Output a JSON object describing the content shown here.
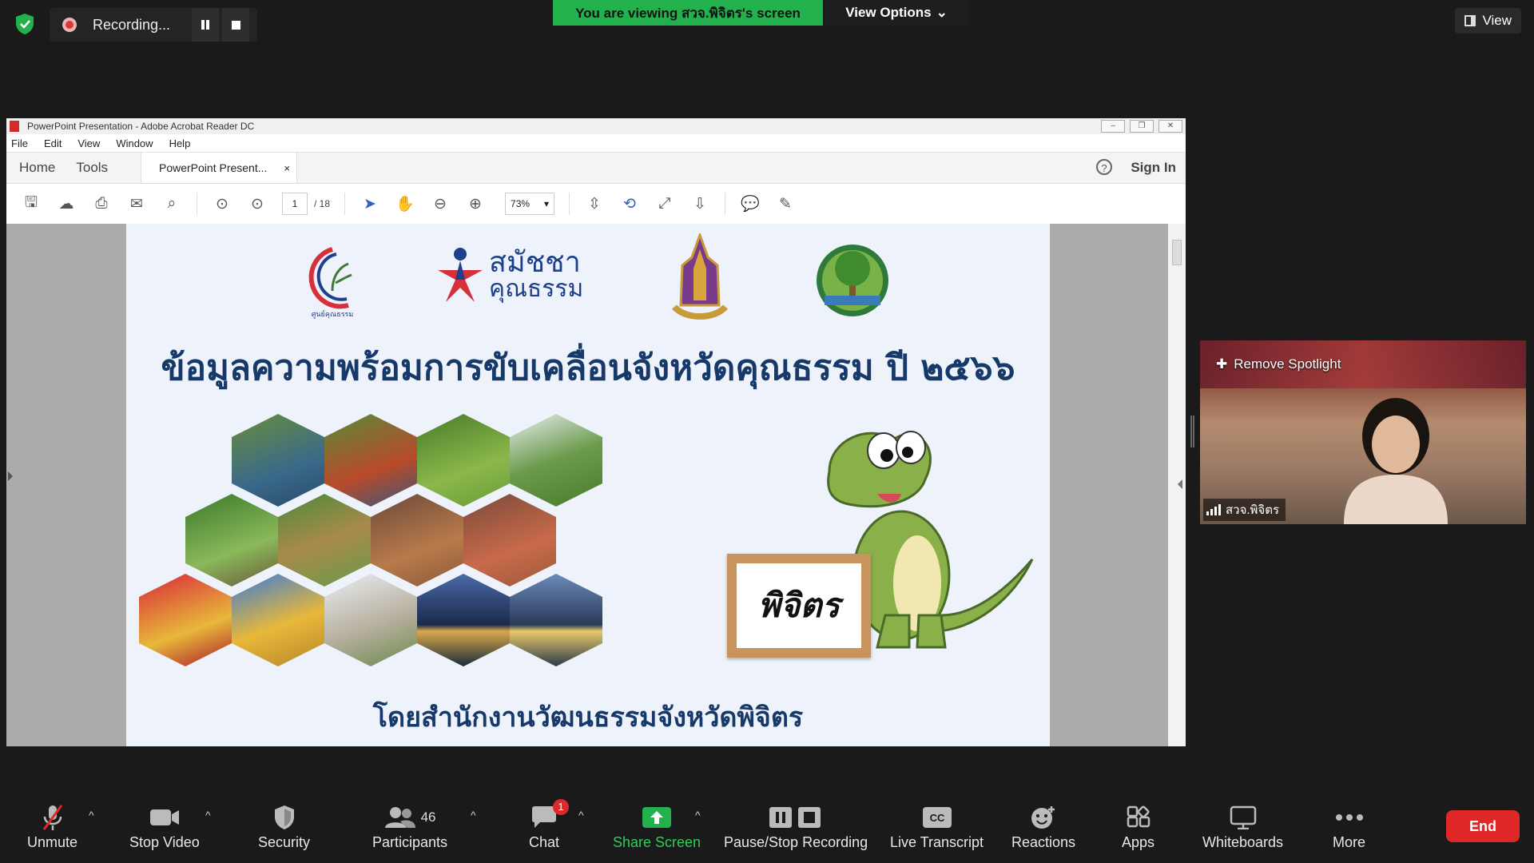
{
  "top": {
    "recording_label": "Recording...",
    "viewing_banner": "You are viewing สวจ.พิจิตร's screen",
    "view_options": "View Options",
    "view_right": "View"
  },
  "acrobat": {
    "title": "PowerPoint Presentation - Adobe Acrobat Reader DC",
    "menu": [
      "File",
      "Edit",
      "View",
      "Window",
      "Help"
    ],
    "tab_home": "Home",
    "tab_tools": "Tools",
    "doc_tab": "PowerPoint Present...",
    "doc_tab_close": "×",
    "help": "?",
    "sign_in": "Sign In",
    "page_current": "1",
    "page_total": "/ 18",
    "zoom": "73%"
  },
  "slide": {
    "title": "ข้อมูลความพร้อมการขับเคลื่อนจังหวัดคุณธรรม ปี ๒๕๖๖",
    "logo_text_1": "สมัชชา",
    "logo_text_2": "คุณธรรม",
    "sign_text": "พิจิตร",
    "footer": "โดยสำนักงานวัฒนธรรมจังหวัดพิจิตร"
  },
  "video": {
    "spotlight_label": "Remove Spotlight",
    "participant_name": "สวจ.พิจิตร"
  },
  "toolbar": {
    "unmute": "Unmute",
    "stop_video": "Stop Video",
    "security": "Security",
    "participants": "Participants",
    "participants_count": "46",
    "chat": "Chat",
    "chat_badge": "1",
    "share_screen": "Share Screen",
    "pause_stop_recording": "Pause/Stop Recording",
    "live_transcript": "Live Transcript",
    "reactions": "Reactions",
    "apps": "Apps",
    "whiteboards": "Whiteboards",
    "more": "More",
    "end": "End"
  },
  "colors": {
    "zoom_green": "#23b14d",
    "end_red": "#e02828",
    "slide_navy": "#17396a"
  }
}
